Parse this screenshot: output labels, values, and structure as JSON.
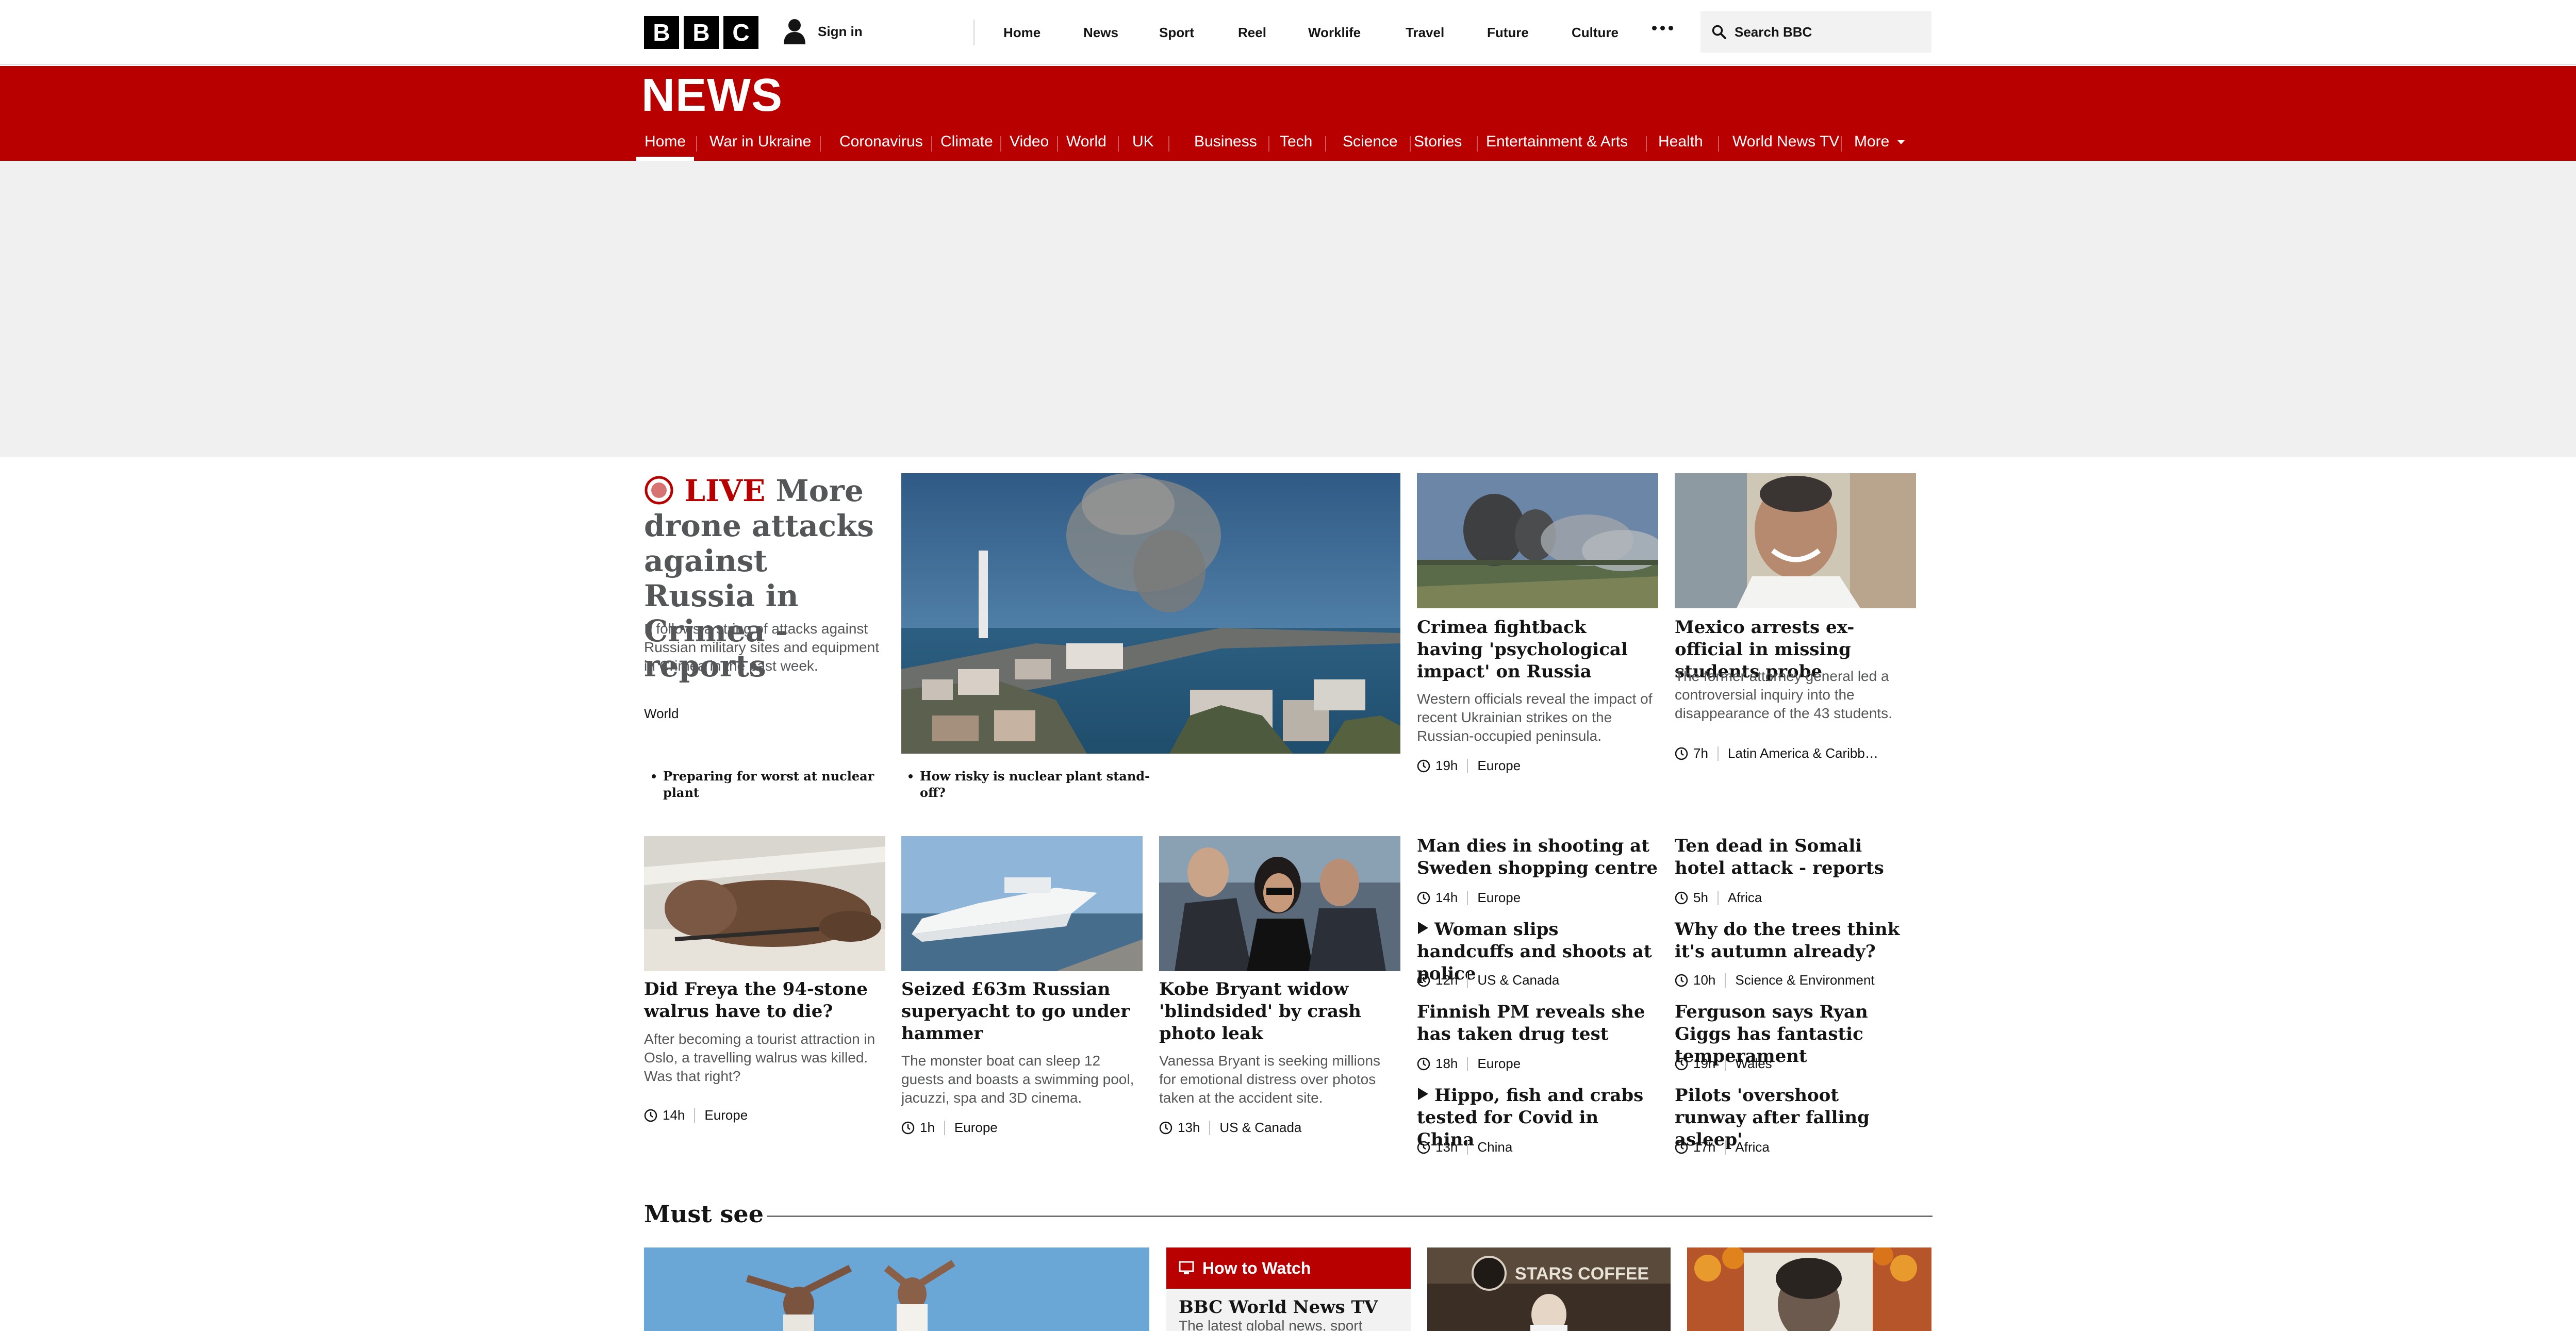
{
  "global_nav": {
    "logo_letters": [
      "B",
      "B",
      "C"
    ],
    "sign_in": "Sign in",
    "items": [
      "Home",
      "News",
      "Sport",
      "Reel",
      "Worklife",
      "Travel",
      "Future",
      "Culture"
    ],
    "search_placeholder": "Search BBC"
  },
  "news_header": {
    "title": "NEWS",
    "nav": [
      "Home",
      "War in Ukraine",
      "Coronavirus",
      "Climate",
      "Video",
      "World",
      "UK",
      "Business",
      "Tech",
      "Science",
      "Stories",
      "Entertainment & Arts",
      "Health",
      "World News TV",
      "More"
    ],
    "active_index": 0
  },
  "lead_story": {
    "live_label": "LIVE",
    "headline": "More drone attacks against Russia in Crimea - reports",
    "summary": "It follows a string of attacks against Russian military sites and equipment in Crimea in the past week.",
    "tag": "World",
    "related": [
      "Preparing for worst at nuclear plant",
      "How risky is nuclear plant stand-off?"
    ]
  },
  "top_stories": [
    {
      "headline": "Crimea fightback having 'psychological impact' on Russia",
      "summary": "Western officials reveal the impact of recent Ukrainian strikes on the Russian-occupied peninsula.",
      "time": "19h",
      "tag": "Europe"
    },
    {
      "headline": "Mexico arrests ex-official in missing students probe",
      "summary": "The former attorney general led a controversial inquiry into the disappearance of the 43 students.",
      "time": "7h",
      "tag": "Latin America & Caribb…"
    }
  ],
  "image_stories": [
    {
      "headline": "Did Freya the 94-stone walrus have to die?",
      "summary": "After becoming a tourist attraction in Oslo, a travelling walrus was killed. Was that right?",
      "time": "14h",
      "tag": "Europe"
    },
    {
      "headline": "Seized £63m Russian superyacht to go under hammer",
      "summary": "The monster boat can sleep 12 guests and boasts a swimming pool, jacuzzi, spa and 3D cinema.",
      "time": "1h",
      "tag": "Europe"
    },
    {
      "headline": "Kobe Bryant widow 'blindsided' by crash photo leak",
      "summary": "Vanessa Bryant is seeking millions for emotional distress over photos taken at the accident site.",
      "time": "13h",
      "tag": "US & Canada"
    }
  ],
  "text_stories_left": [
    {
      "headline": "Man dies in shooting at Sweden shopping centre",
      "time": "14h",
      "tag": "Europe",
      "video": false
    },
    {
      "headline": "Woman slips handcuffs and shoots at police",
      "time": "12h",
      "tag": "US & Canada",
      "video": true
    },
    {
      "headline": "Finnish PM reveals she has taken drug test",
      "time": "18h",
      "tag": "Europe",
      "video": false
    },
    {
      "headline": "Hippo, fish and crabs tested for Covid in China",
      "time": "13h",
      "tag": "China",
      "video": true
    }
  ],
  "text_stories_right": [
    {
      "headline": "Ten dead in Somali hotel attack - reports",
      "time": "5h",
      "tag": "Africa"
    },
    {
      "headline": "Why do the trees think it's autumn already?",
      "time": "10h",
      "tag": "Science & Environment"
    },
    {
      "headline": "Ferguson says Ryan Giggs has fantastic temperament",
      "time": "19h",
      "tag": "Wales"
    },
    {
      "headline": "Pilots 'overshoot runway after falling asleep'",
      "time": "17h",
      "tag": "Africa"
    }
  ],
  "must_see": {
    "title": "Must see",
    "how_to_watch": "How to Watch",
    "tv_title": "BBC World News TV",
    "tv_summary": "The latest global news, sport"
  },
  "colors": {
    "brand_red": "#b80000",
    "live_red": "#b80000",
    "text": "#141414",
    "summary_grey": "#545658"
  }
}
